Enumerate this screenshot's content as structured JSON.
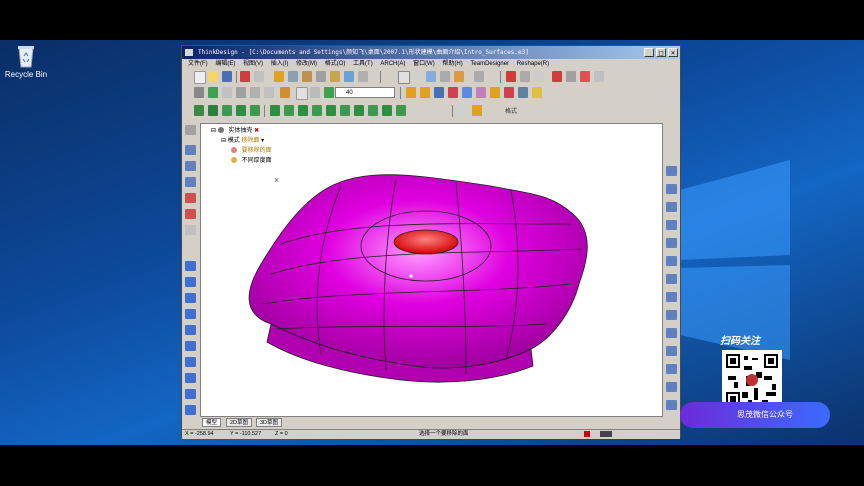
{
  "desktop": {
    "recycle_bin_label": "Recycle Bin"
  },
  "window": {
    "title": "ThinkDesign  - [C:\\Documents and Settings\\颜知飞\\桌面\\2007.1\\形状建模\\曲面介绍\\Intro_Surfaces.e3]",
    "controls": {
      "minimize": "_",
      "maximize": "□",
      "close": "×"
    }
  },
  "menu": [
    "文件(F)",
    "编辑(E)",
    "视图(V)",
    "插入(I)",
    "修改(M)",
    "格式(O)",
    "工具(T)",
    "ARCH(A)",
    "窗口(W)",
    "帮助(H)",
    "TeamDesigner",
    "Reshape(R)"
  ],
  "toolbar": {
    "layer_value": "40",
    "format_label": "格式"
  },
  "tree": {
    "root": "实体抽壳",
    "child": "模式",
    "child_value": "移除面",
    "item_removed": "要移除的面",
    "item_thickness": "不同厚度面"
  },
  "tabs": [
    "模型",
    "2D草图",
    "3D草图"
  ],
  "status": {
    "x": "X = -258.94",
    "y": "Y = -110.527",
    "z": "Z = 0",
    "prompt": "选择一个要移除的面"
  },
  "promo": {
    "title": "扫码关注",
    "caption": "思茂微信公众号"
  },
  "colors": {
    "surface": "#e000e0",
    "selected_face": "#ff2020",
    "titlebar": "#0a246a"
  }
}
